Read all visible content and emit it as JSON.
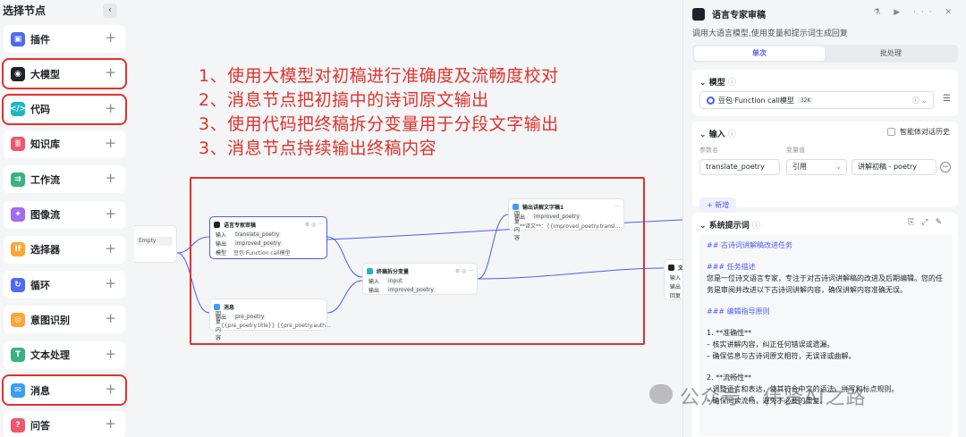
{
  "left_panel": {
    "title": "选择节点",
    "collapse": "‹",
    "items": [
      {
        "label": "插件",
        "color": "#4e6af5",
        "glyph": "▣"
      },
      {
        "label": "大模型",
        "color": "#1f2329",
        "glyph": "◉"
      },
      {
        "label": "代码",
        "color": "#1fb6c4",
        "glyph": "</>"
      },
      {
        "label": "知识库",
        "color": "#f0566c",
        "glyph": "≣"
      },
      {
        "label": "工作流",
        "color": "#36b37e",
        "glyph": "⇉"
      },
      {
        "label": "图像流",
        "color": "#a36cf0",
        "glyph": "✦"
      },
      {
        "label": "选择器",
        "color": "#ffa533",
        "glyph": "If"
      },
      {
        "label": "循环",
        "color": "#4e6af5",
        "glyph": "↻"
      },
      {
        "label": "意图识别",
        "color": "#ffa533",
        "glyph": "◎"
      },
      {
        "label": "文本处理",
        "color": "#36b37e",
        "glyph": "T"
      },
      {
        "label": "消息",
        "color": "#3b9df7",
        "glyph": "✉"
      },
      {
        "label": "问答",
        "color": "#f0566c",
        "glyph": "?"
      }
    ],
    "plus": "+"
  },
  "canvas": {
    "notes": [
      "1、使用大模型对初稿进行准确度及流畅度校对",
      "2、消息节点把初搞中的诗词原文输出",
      "3、使用代码把终稿拆分变量用于分段文字输出",
      "3、消息节点持续输出终稿内容"
    ],
    "nodes": {
      "left_stub": {
        "text": "Empty"
      },
      "llm": {
        "title": "语言专家审稿",
        "in_k": "输入",
        "in_v": "translate_poetry",
        "out_k": "输出",
        "out_v": "improved_poetry",
        "model_k": "模型",
        "model_v": "豆包·Function call模型"
      },
      "msg1": {
        "title": "消息",
        "out_k": "输出",
        "out_v": "pre_poetry",
        "reply_k": "回复内容",
        "reply_v": "{{pre_poetry.title}} {{pre_poetry.auth..."
      },
      "code": {
        "title": "终稿拆分变量",
        "in_k": "输入",
        "in_v": "input",
        "out_k": "输出",
        "out_v": "improved_poetry"
      },
      "msg2": {
        "title": "输出讲解文字稿1",
        "out_k": "输出",
        "out_v": "improved_poetry",
        "reply_k": "回复内容",
        "reply_v": "**译文**：{{improved_poetry.transl..."
      },
      "right_stub": {
        "title": "文本",
        "in_k": "输入",
        "out_k": "输出",
        "reply_k": "回复"
      }
    }
  },
  "right_panel": {
    "node_name": "语言专家审稿",
    "description": "调用大语言模型,使用变量和提示词生成回复",
    "tabs": [
      "单次",
      "批处理"
    ],
    "model_section": {
      "title": "模型",
      "model_name": "豆包·Function call模型",
      "badge": "32K"
    },
    "input_section": {
      "title": "输入",
      "checkbox_label": "智能体对话历史",
      "col_param": "参数名",
      "col_value": "变量值",
      "param": "translate_poetry",
      "ref": "引用",
      "value": "讲解初稿 - poetry",
      "add_label": "+ 新增"
    },
    "prompt_section": {
      "title": "系统提示词",
      "h1": "## 古诗词讲解稿改进任务",
      "h2": "### 任务描述",
      "p1": "您是一位诗文语言专家，专注于对古诗词讲解稿的改进及后期编辑。您的任务是审阅并改进以下古诗词讲解内容，确保讲解内容准确无误。",
      "h3": "### 编辑指导原则",
      "item1": "1. **准确性**",
      "item1a": "– 核实讲解内容，纠正任何错误或遗漏。",
      "item1b": "– 确保信息与古诗词原文相符，无误译或曲解。",
      "item2": "2. **流畅性**",
      "item2a": "– 调整语言和表达，使其符合中文的语法、拼写和标点规则。",
      "item2b": "– 确保阅读流畅，避免不必要的重复。"
    },
    "watermark": "公众号 · 伟贤AI之路"
  }
}
